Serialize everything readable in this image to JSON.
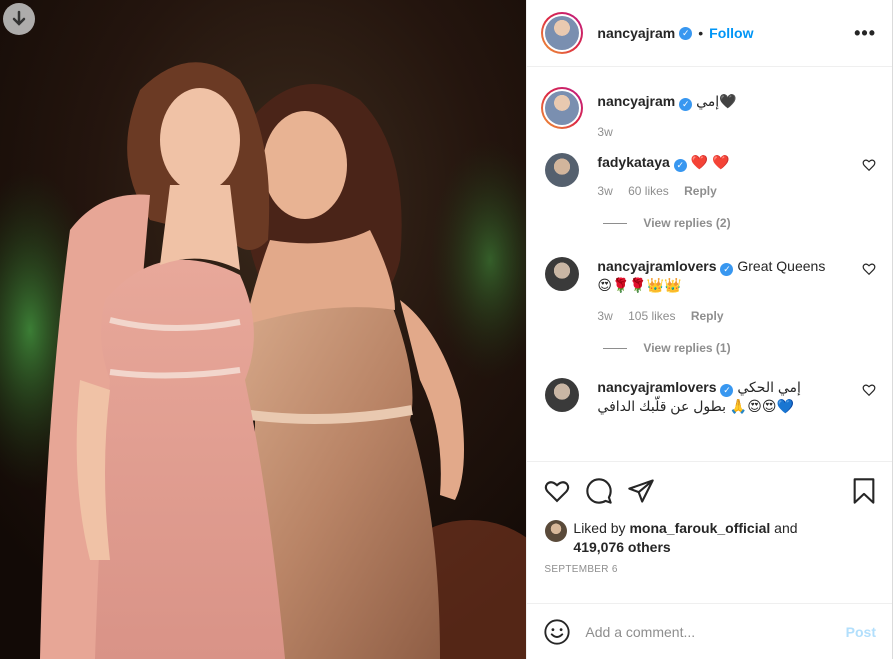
{
  "header": {
    "username": "nancyajram",
    "separator": "•",
    "follow_label": "Follow",
    "more_label": "•••"
  },
  "caption": {
    "username": "nancyajram",
    "text": "إمي🖤",
    "time": "3w"
  },
  "comments": [
    {
      "username": "fadykataya",
      "text": "❤️ ❤️",
      "time": "3w",
      "likes": "60 likes",
      "reply_label": "Reply",
      "view_replies": "View replies (2)"
    },
    {
      "username": "nancyajramlovers",
      "text": "Great Queens",
      "text2": "😍🌹🌹👑👑",
      "time": "3w",
      "likes": "105 likes",
      "reply_label": "Reply",
      "view_replies": "View replies (1)"
    },
    {
      "username": "nancyajramlovers",
      "text": "إمي الحكي",
      "text2": "بطول عن قلّبك الدافي 🙏😍😍💙"
    }
  ],
  "likes": {
    "prefix": "Liked by",
    "user": "mona_farouk_official",
    "joiner": "and",
    "others": "419,076 others"
  },
  "date": "SEPTEMBER 6",
  "add_comment": {
    "placeholder": "Add a comment...",
    "post_label": "Post"
  },
  "icons": [
    "download-icon",
    "verified-badge-icon",
    "more-options-icon",
    "heart-icon",
    "comment-icon",
    "share-icon",
    "save-bookmark-icon",
    "emoji-smile-icon"
  ],
  "colors": {
    "link_blue": "#0095f6",
    "verified_blue": "#3897f0",
    "muted_gray": "#8e8e8e",
    "post_disabled": "#b2dffc",
    "heart_red": "#e0245e"
  }
}
